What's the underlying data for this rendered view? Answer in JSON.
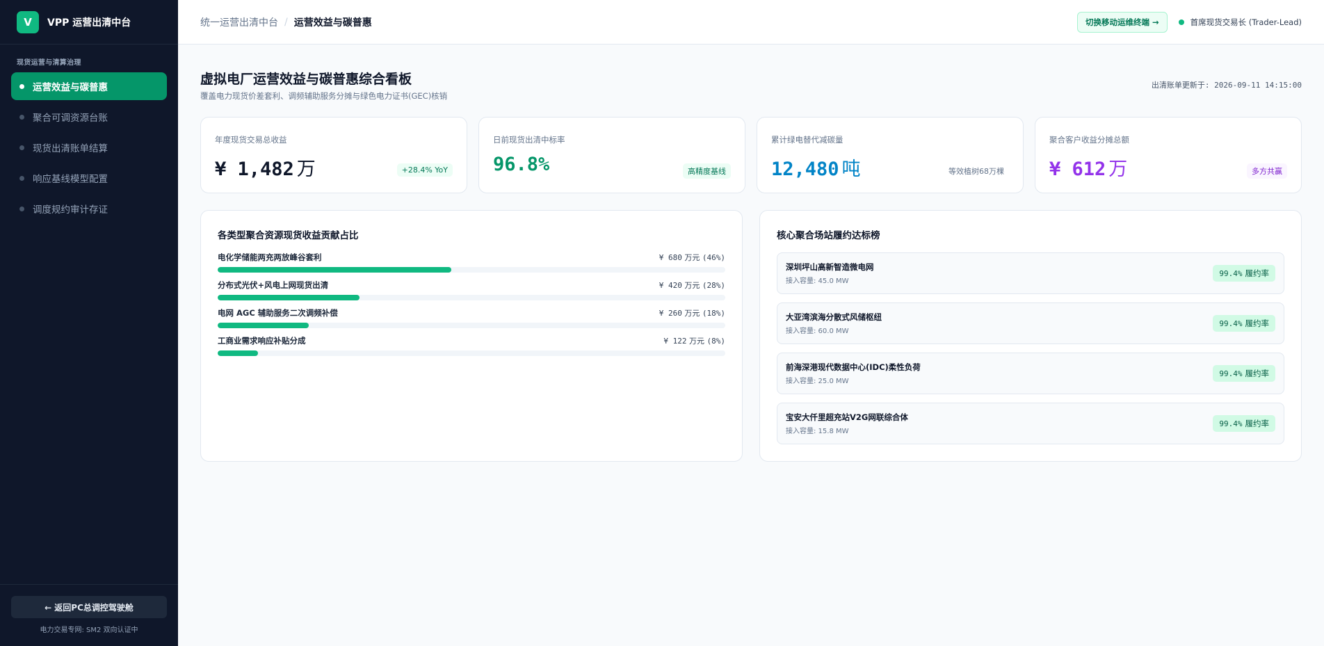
{
  "brand": {
    "logo_letter": "V",
    "title": "VPP 运营出清中台"
  },
  "sidebar": {
    "section_label": "现货运营与清算治理",
    "items": [
      {
        "label": "运营效益与碳普惠",
        "active": true
      },
      {
        "label": "聚合可调资源台账",
        "active": false
      },
      {
        "label": "现货出清账单结算",
        "active": false
      },
      {
        "label": "响应基线模型配置",
        "active": false
      },
      {
        "label": "调度规约审计存证",
        "active": false
      }
    ],
    "back_button": "← 返回PC总调控驾驶舱",
    "footer_note": "电力交易专网: SM2 双向认证中"
  },
  "topbar": {
    "breadcrumb_root": "统一运营出清中台",
    "breadcrumb_sep": "/",
    "breadcrumb_current": "运营效益与碳普惠",
    "switch_button": "切换移动运维终端 →",
    "user_label": "首席现货交易长 (Trader-Lead)",
    "status_color": "#10b981"
  },
  "header": {
    "title": "虚拟电厂运营效益与碳普惠综合看板",
    "subtitle": "覆盖电力现货价差套利、调频辅助服务分摊与绿色电力证书(GEC)核销",
    "updated": "出清账单更新于: 2026-09-11 14:15:00"
  },
  "kpis": [
    {
      "label": "年度现货交易总收益",
      "value": "¥ 1,482",
      "unit": "万",
      "tag": "+28.4% YoY",
      "color": "#0f172a",
      "tag_bg": "#ecfdf5",
      "tag_color": "#047857"
    },
    {
      "label": "日前现货出清中标率",
      "value": "96.8%",
      "unit": "",
      "tag": "高精度基线",
      "color": "#059669",
      "tag_bg": "#ecfdf5",
      "tag_color": "#047857"
    },
    {
      "label": "累计绿电替代减碳量",
      "value": "12,480",
      "unit": "吨",
      "tag": "等效植树68万棵",
      "color": "#0284c7",
      "tag_bg": "transparent",
      "tag_color": "#64748b"
    },
    {
      "label": "聚合客户收益分摊总额",
      "value": "¥ 612",
      "unit": "万",
      "tag": "多方共赢",
      "color": "#9333ea",
      "tag_bg": "#faf5ff",
      "tag_color": "#7e22ce"
    }
  ],
  "contribution": {
    "title": "各类型聚合资源现货收益贡献占比",
    "items": [
      {
        "label": "电化学储能两充两放峰谷套利",
        "value": "¥ 680",
        "unit": "万元",
        "pct_label": "(46%)",
        "share": 0.46
      },
      {
        "label": "分布式光伏+风电上网现货出清",
        "value": "¥ 420",
        "unit": "万元",
        "pct_label": "(28%)",
        "share": 0.28
      },
      {
        "label": "电网 AGC 辅助服务二次调频补偿",
        "value": "¥ 260",
        "unit": "万元",
        "pct_label": "(18%)",
        "share": 0.18
      },
      {
        "label": "工商业需求响应补贴分成",
        "value": "¥ 122",
        "unit": "万元",
        "pct_label": "(8%)",
        "share": 0.08
      }
    ]
  },
  "ranking": {
    "title": "核心聚合场站履约达标榜",
    "stations": [
      {
        "name": "深圳坪山高新智造微电网",
        "capacity": "接入容量: 45.0 MW",
        "rate": "99.4%",
        "rate_label": "履约率"
      },
      {
        "name": "大亚湾滨海分散式风储枢纽",
        "capacity": "接入容量: 60.0 MW",
        "rate": "99.4%",
        "rate_label": "履约率"
      },
      {
        "name": "前海深港现代数据中心(IDC)柔性负荷",
        "capacity": "接入容量: 25.0 MW",
        "rate": "99.4%",
        "rate_label": "履约率"
      },
      {
        "name": "宝安大仟里超充站V2G网联综合体",
        "capacity": "接入容量: 15.8 MW",
        "rate": "99.4%",
        "rate_label": "履约率"
      }
    ]
  }
}
